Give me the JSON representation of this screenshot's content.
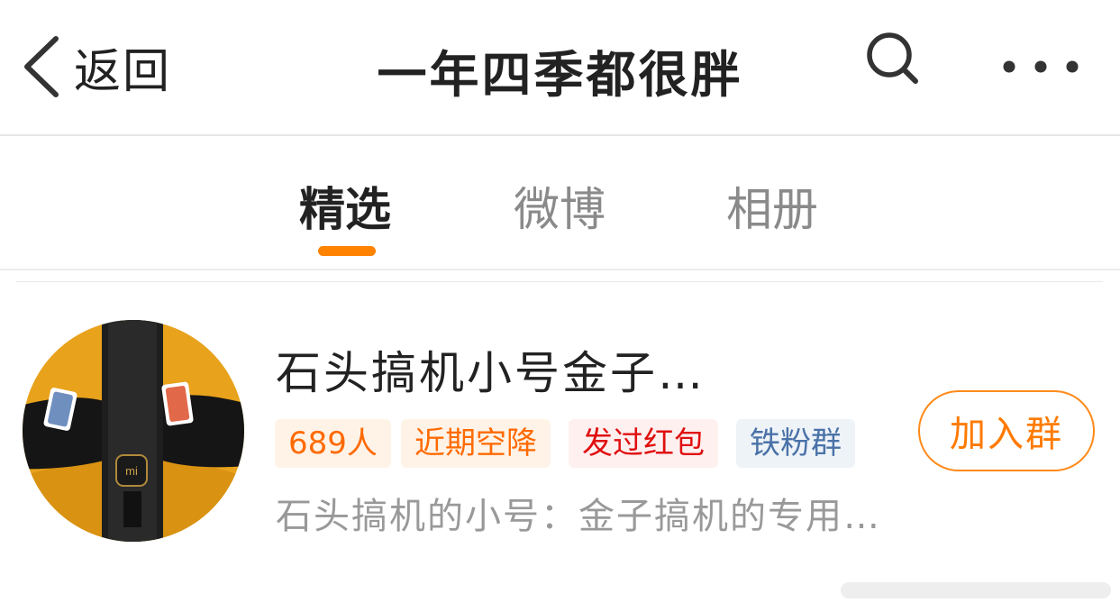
{
  "header": {
    "back_label": "返回",
    "title": "一年四季都很胖",
    "search_icon": "search-icon",
    "more_icon": "more-dots-icon"
  },
  "tabs": [
    {
      "label": "精选",
      "active": true
    },
    {
      "label": "微博",
      "active": false
    },
    {
      "label": "相册",
      "active": false
    }
  ],
  "group": {
    "name": "石头搞机小号金子…",
    "badges": [
      {
        "label": "689人"
      },
      {
        "label": "近期空降"
      },
      {
        "label": "发过红包"
      },
      {
        "label": "铁粉群"
      }
    ],
    "description": "石头搞机的小号：金子搞机的专用…",
    "join_label": "加入群"
  },
  "colors": {
    "accent": "#ff8200",
    "badge_orange": "#ff6a00",
    "badge_red": "#e01010",
    "badge_blue": "#4a72a8"
  }
}
